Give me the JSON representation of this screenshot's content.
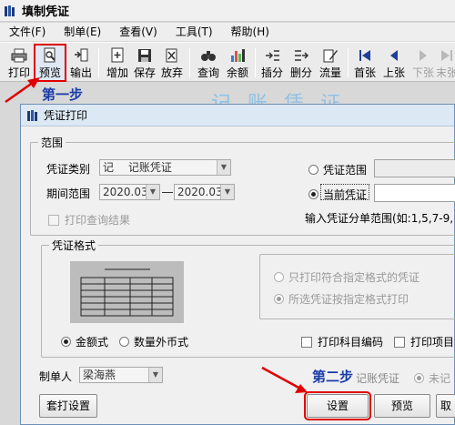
{
  "window": {
    "title": "填制凭证",
    "icon": "books-icon"
  },
  "menu": [
    "文件(F)",
    "制单(E)",
    "查看(V)",
    "工具(T)",
    "帮助(H)"
  ],
  "toolbar": {
    "print": "打印",
    "preview": "预览",
    "export": "输出",
    "add": "增加",
    "save": "保存",
    "discard": "放弃",
    "query": "查询",
    "balance": "余额",
    "insert_row": "插分",
    "delete_row": "删分",
    "flow": "流量",
    "first": "首张",
    "prev": "上张",
    "next": "下张",
    "last": "末张"
  },
  "annotations": {
    "step1": "第一步",
    "step2": "第二步",
    "bg_title": "记账凭证"
  },
  "dialog": {
    "title": "凭证打印",
    "scope": {
      "legend": "范围",
      "type_label": "凭证类别",
      "type_code": "记",
      "type_value": "记账凭证",
      "period_label": "期间范围",
      "period_from": "2020.03",
      "period_to": "2020.03",
      "opt_range": "凭证范围",
      "opt_current": "当前凭证",
      "print_query_result": "打印查询结果",
      "hint": "输入凭证分单范围(如:1,5,7-9,"
    },
    "format": {
      "legend": "凭证格式",
      "opt_matching_only": "只打印符合指定格式的凭证",
      "opt_selected_format": "所选凭证按指定格式打印",
      "opt_amount": "金额式",
      "opt_quantity_foreign": "数量外币式",
      "print_subject_code": "打印科目编码",
      "print_item": "打印项目"
    },
    "maker_label": "制单人",
    "maker_value": "梁海燕",
    "posted_voucher": "记账凭证",
    "unposted": "未记",
    "buttons": {
      "template_setup": "套打设置",
      "settings": "设置",
      "preview": "预览",
      "other": "取"
    }
  },
  "colors": {
    "step_text": "#1a3ca8",
    "highlight": "#e00000",
    "arrow": "#e00000"
  }
}
